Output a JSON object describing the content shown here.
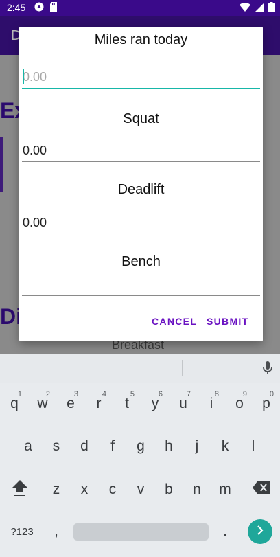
{
  "status_bar": {
    "time": "2:45"
  },
  "background": {
    "app_title": "D",
    "heading_1": "Ex",
    "heading_2": "Di",
    "peek_text": "Breakfast"
  },
  "dialog": {
    "title": "Miles ran today",
    "fields": [
      {
        "label": "",
        "value": "",
        "placeholder": "0.00"
      },
      {
        "label": "Squat",
        "value": "0.00",
        "placeholder": ""
      },
      {
        "label": "Deadlift",
        "value": "0.00",
        "placeholder": ""
      },
      {
        "label": "Bench",
        "value": "",
        "placeholder": ""
      }
    ],
    "cancel_label": "CANCEL",
    "submit_label": "SUBMIT",
    "accent_color": "#6a12c2",
    "focus_color": "#17b7a8"
  },
  "keyboard": {
    "row1": [
      {
        "key": "q",
        "hint": "1"
      },
      {
        "key": "w",
        "hint": "2"
      },
      {
        "key": "e",
        "hint": "3"
      },
      {
        "key": "r",
        "hint": "4"
      },
      {
        "key": "t",
        "hint": "5"
      },
      {
        "key": "y",
        "hint": "6"
      },
      {
        "key": "u",
        "hint": "7"
      },
      {
        "key": "i",
        "hint": "8"
      },
      {
        "key": "o",
        "hint": "9"
      },
      {
        "key": "p",
        "hint": "0"
      }
    ],
    "row2": [
      "a",
      "s",
      "d",
      "f",
      "g",
      "h",
      "j",
      "k",
      "l"
    ],
    "row3": [
      "z",
      "x",
      "c",
      "v",
      "b",
      "n",
      "m"
    ],
    "symbols_label": "?123",
    "comma": ",",
    "period": "."
  }
}
